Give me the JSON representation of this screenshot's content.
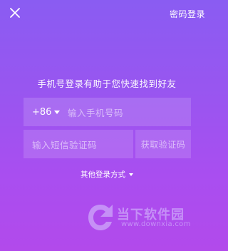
{
  "header": {
    "close_icon": "close-icon",
    "password_login_label": "密码登录"
  },
  "main": {
    "subtitle": "手机号登录有助于您快速找到好友",
    "phone": {
      "country_code": "+86",
      "placeholder": "输入手机号码"
    },
    "verification": {
      "placeholder": "输入短信验证码",
      "get_code_label": "获取验证码"
    },
    "other_login_label": "其他登录方式"
  },
  "watermark": {
    "name": "当下软件园",
    "url": "www.downxia.com"
  },
  "colors": {
    "background_top": "#8a5cf2",
    "background_bottom": "#b24aeb",
    "field_fill": "rgba(255,255,255,0.14)"
  }
}
